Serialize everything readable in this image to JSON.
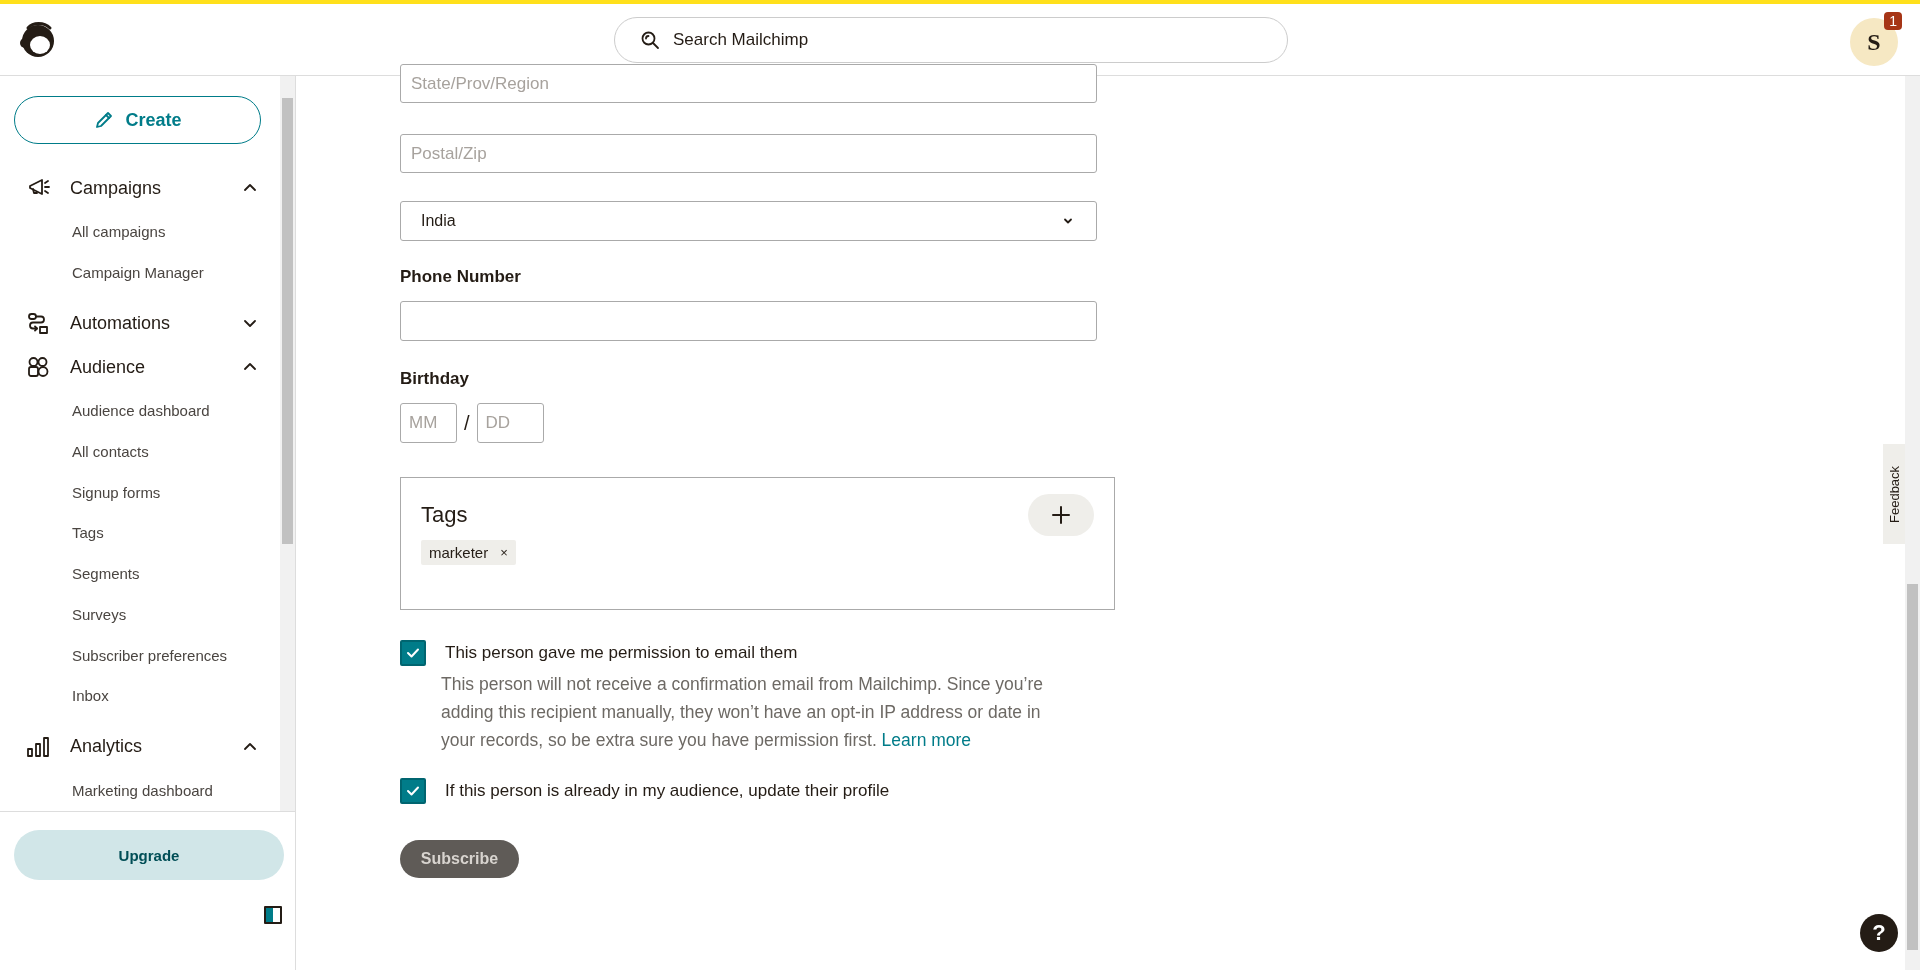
{
  "header": {
    "search": {
      "placeholder": "Search Mailchimp"
    },
    "avatar": {
      "letter": "S",
      "badge": "1"
    }
  },
  "sidebar": {
    "create": "Create",
    "nav": [
      {
        "label": "Campaigns",
        "kind": "campaigns",
        "expanded": true,
        "children": [
          "All campaigns",
          "Campaign Manager"
        ]
      },
      {
        "label": "Automations",
        "kind": "automations",
        "expanded": false
      },
      {
        "label": "Audience",
        "kind": "audience",
        "expanded": true,
        "children": [
          "Audience dashboard",
          "All contacts",
          "Signup forms",
          "Tags",
          "Segments",
          "Surveys",
          "Subscriber preferences",
          "Inbox"
        ]
      },
      {
        "label": "Analytics",
        "kind": "analytics",
        "expanded": true,
        "children": [
          "Marketing dashboard"
        ]
      }
    ],
    "upgrade": "Upgrade"
  },
  "form": {
    "state": {
      "placeholder": "State/Prov/Region"
    },
    "postal": {
      "placeholder": "Postal/Zip"
    },
    "country": {
      "value": "India"
    },
    "phone": {
      "label": "Phone Number"
    },
    "birthday": {
      "label": "Birthday",
      "month_placeholder": "MM",
      "separator": "/",
      "day_placeholder": "DD"
    },
    "tags": {
      "title": "Tags",
      "items": [
        {
          "label": "marketer",
          "remove": "×"
        }
      ]
    },
    "consents": [
      {
        "label": "This person gave me permission to email them",
        "checked": true,
        "description": "This person will not receive a confirmation email from Mailchimp. Since you’re adding this recipient manually, they won’t have an opt-in IP address or date in your records, so be extra sure you have permission first.",
        "link": "Learn more"
      },
      {
        "label": "If this person is already in my audience, update their profile",
        "checked": true
      }
    ],
    "submit": "Subscribe"
  },
  "feedback": "Feedback",
  "help": "?"
}
